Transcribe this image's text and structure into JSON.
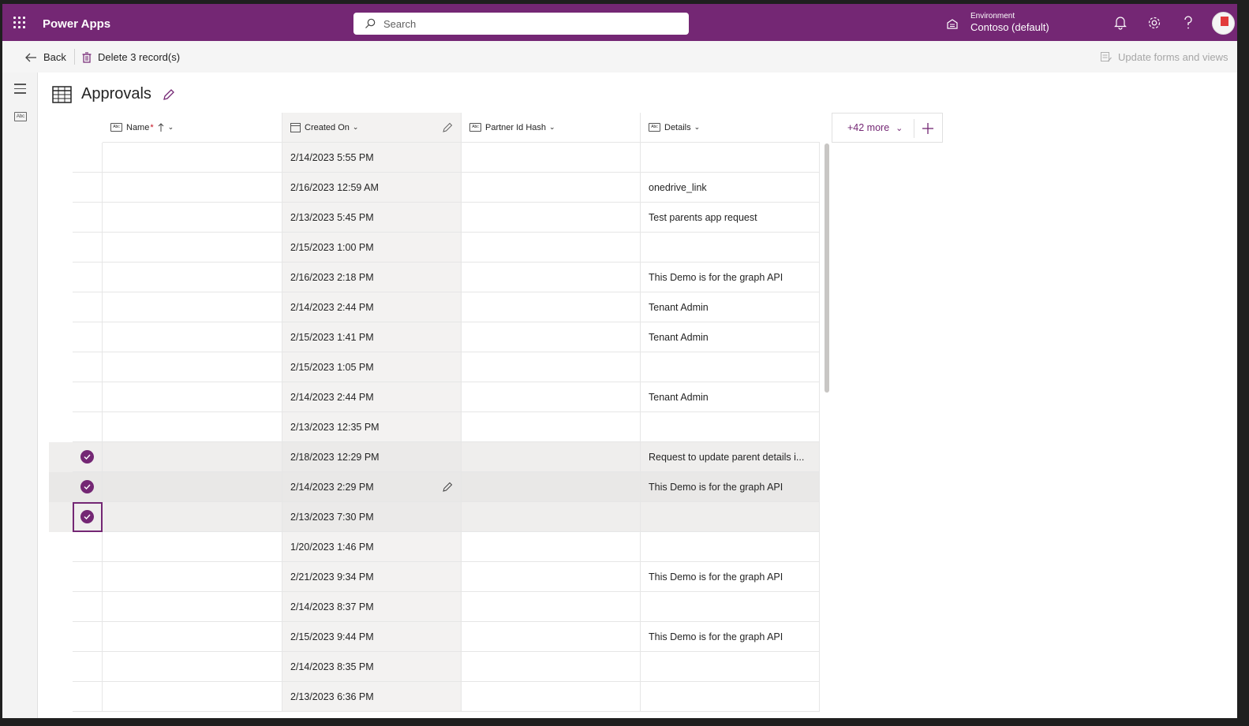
{
  "app": {
    "name": "Power Apps"
  },
  "search": {
    "placeholder": "Search"
  },
  "environment": {
    "label": "Environment",
    "value": "Contoso (default)"
  },
  "icons": {
    "waffle": "app-launcher-icon",
    "search": "search-icon",
    "environment": "environment-icon",
    "bell": "bell-icon",
    "gear": "gear-icon",
    "help": "help-icon",
    "avatar": "avatar",
    "edit": "pencil-icon",
    "table": "table-icon"
  },
  "commands": {
    "back": "Back",
    "delete": "Delete 3 record(s)",
    "update": "Update forms and views"
  },
  "table": {
    "title": "Approvals"
  },
  "columns": {
    "name": "Name",
    "name_required": "*",
    "created": "Created On",
    "partner": "Partner Id Hash",
    "details": "Details",
    "more": "+42 more"
  },
  "rows": [
    {
      "created": "2/14/2023 5:55 PM",
      "details": ""
    },
    {
      "created": "2/16/2023 12:59 AM",
      "details": "onedrive_link"
    },
    {
      "created": "2/13/2023 5:45 PM",
      "details": "Test parents app request"
    },
    {
      "created": "2/15/2023 1:00 PM",
      "details": ""
    },
    {
      "created": "2/16/2023 2:18 PM",
      "details": "This Demo is for the graph API"
    },
    {
      "created": "2/14/2023 2:44 PM",
      "details": "Tenant Admin"
    },
    {
      "created": "2/15/2023 1:41 PM",
      "details": "Tenant Admin"
    },
    {
      "created": "2/15/2023 1:05 PM",
      "details": ""
    },
    {
      "created": "2/14/2023 2:44 PM",
      "details": "Tenant Admin"
    },
    {
      "created": "2/13/2023 12:35 PM",
      "details": ""
    },
    {
      "created": "2/18/2023 12:29 PM",
      "details": "Request to update parent details i..."
    },
    {
      "created": "2/14/2023 2:29 PM",
      "details": "This Demo is for the graph API"
    },
    {
      "created": "2/13/2023 7:30 PM",
      "details": ""
    },
    {
      "created": "1/20/2023 1:46 PM",
      "details": ""
    },
    {
      "created": "2/21/2023 9:34 PM",
      "details": "This Demo is for the graph API"
    },
    {
      "created": "2/14/2023 8:37 PM",
      "details": ""
    },
    {
      "created": "2/15/2023 9:44 PM",
      "details": "This Demo is for the graph API"
    },
    {
      "created": "2/14/2023 8:35 PM",
      "details": ""
    },
    {
      "created": "2/13/2023 6:36 PM",
      "details": ""
    }
  ],
  "colors": {
    "brand": "#742774",
    "selected_row": "#efeeed"
  }
}
